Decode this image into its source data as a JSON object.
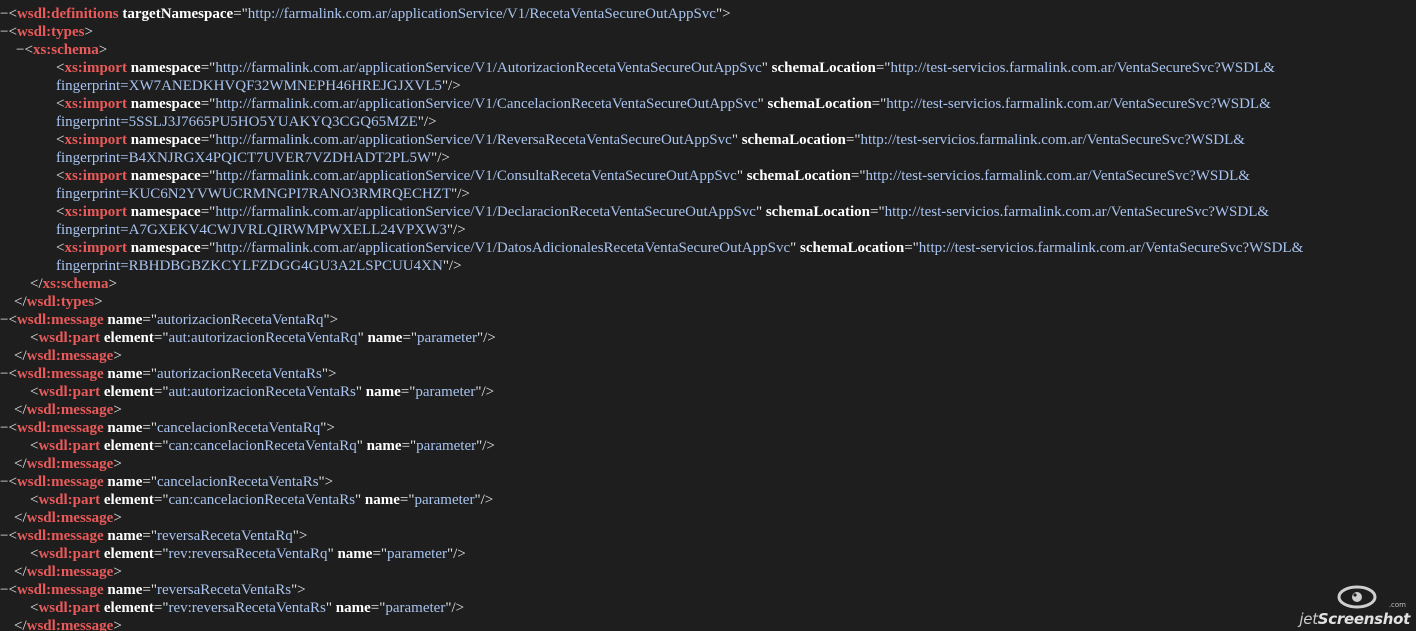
{
  "lines": [
    {
      "indent": 0,
      "fold": "−",
      "tokens": [
        [
          "p",
          "<"
        ],
        [
          "t",
          "wsdl:definitions"
        ],
        [
          "p",
          " "
        ],
        [
          "a",
          "targetNamespace"
        ],
        [
          "p",
          "=\""
        ],
        [
          "v",
          "http://farmalink.com.ar/applicationService/V1/RecetaVentaSecureOutAppSvc"
        ],
        [
          "p",
          "\">"
        ]
      ]
    },
    {
      "indent": 1,
      "fold": "−",
      "tokens": [
        [
          "p",
          "<"
        ],
        [
          "t",
          "wsdl:types"
        ],
        [
          "p",
          ">"
        ]
      ]
    },
    {
      "indent": 2,
      "fold": "−",
      "tokens": [
        [
          "p",
          "<"
        ],
        [
          "t",
          "xs:schema"
        ],
        [
          "p",
          ">"
        ]
      ]
    },
    {
      "indent": 3,
      "fold": "",
      "tokens": [
        [
          "p",
          "<"
        ],
        [
          "t",
          "xs:import"
        ],
        [
          "p",
          " "
        ],
        [
          "a",
          "namespace"
        ],
        [
          "p",
          "=\""
        ],
        [
          "v",
          "http://farmalink.com.ar/applicationService/V1/AutorizacionRecetaVentaSecureOutAppSvc"
        ],
        [
          "p",
          "\" "
        ],
        [
          "a",
          "schemaLocation"
        ],
        [
          "p",
          "=\""
        ],
        [
          "v",
          "http://test-servicios.farmalink.com.ar/VentaSecureSvc?WSDL&"
        ]
      ]
    },
    {
      "indent": 3,
      "fold": "",
      "tokens": [
        [
          "v",
          "fingerprint=XW7ANEDKHVQF32WMNEPH46HREJGJXVL5"
        ],
        [
          "p",
          "\"/>"
        ]
      ]
    },
    {
      "indent": 3,
      "fold": "",
      "tokens": [
        [
          "p",
          "<"
        ],
        [
          "t",
          "xs:import"
        ],
        [
          "p",
          " "
        ],
        [
          "a",
          "namespace"
        ],
        [
          "p",
          "=\""
        ],
        [
          "v",
          "http://farmalink.com.ar/applicationService/V1/CancelacionRecetaVentaSecureOutAppSvc"
        ],
        [
          "p",
          "\" "
        ],
        [
          "a",
          "schemaLocation"
        ],
        [
          "p",
          "=\""
        ],
        [
          "v",
          "http://test-servicios.farmalink.com.ar/VentaSecureSvc?WSDL&"
        ]
      ]
    },
    {
      "indent": 3,
      "fold": "",
      "tokens": [
        [
          "v",
          "fingerprint=5SSLJ3J7665PU5HO5YUAKYQ3CGQ65MZE"
        ],
        [
          "p",
          "\"/>"
        ]
      ]
    },
    {
      "indent": 3,
      "fold": "",
      "tokens": [
        [
          "p",
          "<"
        ],
        [
          "t",
          "xs:import"
        ],
        [
          "p",
          " "
        ],
        [
          "a",
          "namespace"
        ],
        [
          "p",
          "=\""
        ],
        [
          "v",
          "http://farmalink.com.ar/applicationService/V1/ReversaRecetaVentaSecureOutAppSvc"
        ],
        [
          "p",
          "\" "
        ],
        [
          "a",
          "schemaLocation"
        ],
        [
          "p",
          "=\""
        ],
        [
          "v",
          "http://test-servicios.farmalink.com.ar/VentaSecureSvc?WSDL&"
        ]
      ]
    },
    {
      "indent": 3,
      "fold": "",
      "tokens": [
        [
          "v",
          "fingerprint=B4XNJRGX4PQICT7UVER7VZDHADT2PL5W"
        ],
        [
          "p",
          "\"/>"
        ]
      ]
    },
    {
      "indent": 3,
      "fold": "",
      "tokens": [
        [
          "p",
          "<"
        ],
        [
          "t",
          "xs:import"
        ],
        [
          "p",
          " "
        ],
        [
          "a",
          "namespace"
        ],
        [
          "p",
          "=\""
        ],
        [
          "v",
          "http://farmalink.com.ar/applicationService/V1/ConsultaRecetaVentaSecureOutAppSvc"
        ],
        [
          "p",
          "\" "
        ],
        [
          "a",
          "schemaLocation"
        ],
        [
          "p",
          "=\""
        ],
        [
          "v",
          "http://test-servicios.farmalink.com.ar/VentaSecureSvc?WSDL&"
        ]
      ]
    },
    {
      "indent": 3,
      "fold": "",
      "tokens": [
        [
          "v",
          "fingerprint=KUC6N2YVWUCRMNGPI7RANO3RMRQECHZT"
        ],
        [
          "p",
          "\"/>"
        ]
      ]
    },
    {
      "indent": 3,
      "fold": "",
      "tokens": [
        [
          "p",
          "<"
        ],
        [
          "t",
          "xs:import"
        ],
        [
          "p",
          " "
        ],
        [
          "a",
          "namespace"
        ],
        [
          "p",
          "=\""
        ],
        [
          "v",
          "http://farmalink.com.ar/applicationService/V1/DeclaracionRecetaVentaSecureOutAppSvc"
        ],
        [
          "p",
          "\" "
        ],
        [
          "a",
          "schemaLocation"
        ],
        [
          "p",
          "=\""
        ],
        [
          "v",
          "http://test-servicios.farmalink.com.ar/VentaSecureSvc?WSDL&"
        ]
      ]
    },
    {
      "indent": 3,
      "fold": "",
      "tokens": [
        [
          "v",
          "fingerprint=A7GXEKV4CWJVRLQIRWMPWXELL24VPXW3"
        ],
        [
          "p",
          "\"/>"
        ]
      ]
    },
    {
      "indent": 3,
      "fold": "",
      "tokens": [
        [
          "p",
          "<"
        ],
        [
          "t",
          "xs:import"
        ],
        [
          "p",
          " "
        ],
        [
          "a",
          "namespace"
        ],
        [
          "p",
          "=\""
        ],
        [
          "v",
          "http://farmalink.com.ar/applicationService/V1/DatosAdicionalesRecetaVentaSecureOutAppSvc"
        ],
        [
          "p",
          "\" "
        ],
        [
          "a",
          "schemaLocation"
        ],
        [
          "p",
          "=\""
        ],
        [
          "v",
          "http://test-servicios.farmalink.com.ar/VentaSecureSvc?WSDL&"
        ]
      ]
    },
    {
      "indent": 3,
      "fold": "",
      "tokens": [
        [
          "v",
          "fingerprint=RBHDBGBZKCYLFZDGG4GU3A2LSPCUU4XN"
        ],
        [
          "p",
          "\"/>"
        ]
      ]
    },
    {
      "indent": 2,
      "fold": "",
      "tokens": [
        [
          "p",
          "</"
        ],
        [
          "t",
          "xs:schema"
        ],
        [
          "p",
          ">"
        ]
      ]
    },
    {
      "indent": 1,
      "fold": "",
      "tokens": [
        [
          "p",
          "</"
        ],
        [
          "t",
          "wsdl:types"
        ],
        [
          "p",
          ">"
        ]
      ]
    },
    {
      "indent": 1,
      "fold": "−",
      "tokens": [
        [
          "p",
          "<"
        ],
        [
          "t",
          "wsdl:message"
        ],
        [
          "p",
          " "
        ],
        [
          "a",
          "name"
        ],
        [
          "p",
          "=\""
        ],
        [
          "v",
          "autorizacionRecetaVentaRq"
        ],
        [
          "p",
          "\">"
        ]
      ]
    },
    {
      "indent": 2,
      "fold": "",
      "tokens": [
        [
          "p",
          "<"
        ],
        [
          "t",
          "wsdl:part"
        ],
        [
          "p",
          " "
        ],
        [
          "a",
          "element"
        ],
        [
          "p",
          "=\""
        ],
        [
          "v",
          "aut:autorizacionRecetaVentaRq"
        ],
        [
          "p",
          "\" "
        ],
        [
          "a",
          "name"
        ],
        [
          "p",
          "=\""
        ],
        [
          "v",
          "parameter"
        ],
        [
          "p",
          "\"/>"
        ]
      ]
    },
    {
      "indent": 1,
      "fold": "",
      "tokens": [
        [
          "p",
          "</"
        ],
        [
          "t",
          "wsdl:message"
        ],
        [
          "p",
          ">"
        ]
      ]
    },
    {
      "indent": 1,
      "fold": "−",
      "tokens": [
        [
          "p",
          "<"
        ],
        [
          "t",
          "wsdl:message"
        ],
        [
          "p",
          " "
        ],
        [
          "a",
          "name"
        ],
        [
          "p",
          "=\""
        ],
        [
          "v",
          "autorizacionRecetaVentaRs"
        ],
        [
          "p",
          "\">"
        ]
      ]
    },
    {
      "indent": 2,
      "fold": "",
      "tokens": [
        [
          "p",
          "<"
        ],
        [
          "t",
          "wsdl:part"
        ],
        [
          "p",
          " "
        ],
        [
          "a",
          "element"
        ],
        [
          "p",
          "=\""
        ],
        [
          "v",
          "aut:autorizacionRecetaVentaRs"
        ],
        [
          "p",
          "\" "
        ],
        [
          "a",
          "name"
        ],
        [
          "p",
          "=\""
        ],
        [
          "v",
          "parameter"
        ],
        [
          "p",
          "\"/>"
        ]
      ]
    },
    {
      "indent": 1,
      "fold": "",
      "tokens": [
        [
          "p",
          "</"
        ],
        [
          "t",
          "wsdl:message"
        ],
        [
          "p",
          ">"
        ]
      ]
    },
    {
      "indent": 1,
      "fold": "−",
      "tokens": [
        [
          "p",
          "<"
        ],
        [
          "t",
          "wsdl:message"
        ],
        [
          "p",
          " "
        ],
        [
          "a",
          "name"
        ],
        [
          "p",
          "=\""
        ],
        [
          "v",
          "cancelacionRecetaVentaRq"
        ],
        [
          "p",
          "\">"
        ]
      ]
    },
    {
      "indent": 2,
      "fold": "",
      "tokens": [
        [
          "p",
          "<"
        ],
        [
          "t",
          "wsdl:part"
        ],
        [
          "p",
          " "
        ],
        [
          "a",
          "element"
        ],
        [
          "p",
          "=\""
        ],
        [
          "v",
          "can:cancelacionRecetaVentaRq"
        ],
        [
          "p",
          "\" "
        ],
        [
          "a",
          "name"
        ],
        [
          "p",
          "=\""
        ],
        [
          "v",
          "parameter"
        ],
        [
          "p",
          "\"/>"
        ]
      ]
    },
    {
      "indent": 1,
      "fold": "",
      "tokens": [
        [
          "p",
          "</"
        ],
        [
          "t",
          "wsdl:message"
        ],
        [
          "p",
          ">"
        ]
      ]
    },
    {
      "indent": 1,
      "fold": "−",
      "tokens": [
        [
          "p",
          "<"
        ],
        [
          "t",
          "wsdl:message"
        ],
        [
          "p",
          " "
        ],
        [
          "a",
          "name"
        ],
        [
          "p",
          "=\""
        ],
        [
          "v",
          "cancelacionRecetaVentaRs"
        ],
        [
          "p",
          "\">"
        ]
      ]
    },
    {
      "indent": 2,
      "fold": "",
      "tokens": [
        [
          "p",
          "<"
        ],
        [
          "t",
          "wsdl:part"
        ],
        [
          "p",
          " "
        ],
        [
          "a",
          "element"
        ],
        [
          "p",
          "=\""
        ],
        [
          "v",
          "can:cancelacionRecetaVentaRs"
        ],
        [
          "p",
          "\" "
        ],
        [
          "a",
          "name"
        ],
        [
          "p",
          "=\""
        ],
        [
          "v",
          "parameter"
        ],
        [
          "p",
          "\"/>"
        ]
      ]
    },
    {
      "indent": 1,
      "fold": "",
      "tokens": [
        [
          "p",
          "</"
        ],
        [
          "t",
          "wsdl:message"
        ],
        [
          "p",
          ">"
        ]
      ]
    },
    {
      "indent": 1,
      "fold": "−",
      "tokens": [
        [
          "p",
          "<"
        ],
        [
          "t",
          "wsdl:message"
        ],
        [
          "p",
          " "
        ],
        [
          "a",
          "name"
        ],
        [
          "p",
          "=\""
        ],
        [
          "v",
          "reversaRecetaVentaRq"
        ],
        [
          "p",
          "\">"
        ]
      ]
    },
    {
      "indent": 2,
      "fold": "",
      "tokens": [
        [
          "p",
          "<"
        ],
        [
          "t",
          "wsdl:part"
        ],
        [
          "p",
          " "
        ],
        [
          "a",
          "element"
        ],
        [
          "p",
          "=\""
        ],
        [
          "v",
          "rev:reversaRecetaVentaRq"
        ],
        [
          "p",
          "\" "
        ],
        [
          "a",
          "name"
        ],
        [
          "p",
          "=\""
        ],
        [
          "v",
          "parameter"
        ],
        [
          "p",
          "\"/>"
        ]
      ]
    },
    {
      "indent": 1,
      "fold": "",
      "tokens": [
        [
          "p",
          "</"
        ],
        [
          "t",
          "wsdl:message"
        ],
        [
          "p",
          ">"
        ]
      ]
    },
    {
      "indent": 1,
      "fold": "−",
      "tokens": [
        [
          "p",
          "<"
        ],
        [
          "t",
          "wsdl:message"
        ],
        [
          "p",
          " "
        ],
        [
          "a",
          "name"
        ],
        [
          "p",
          "=\""
        ],
        [
          "v",
          "reversaRecetaVentaRs"
        ],
        [
          "p",
          "\">"
        ]
      ]
    },
    {
      "indent": 2,
      "fold": "",
      "tokens": [
        [
          "p",
          "<"
        ],
        [
          "t",
          "wsdl:part"
        ],
        [
          "p",
          " "
        ],
        [
          "a",
          "element"
        ],
        [
          "p",
          "=\""
        ],
        [
          "v",
          "rev:reversaRecetaVentaRs"
        ],
        [
          "p",
          "\" "
        ],
        [
          "a",
          "name"
        ],
        [
          "p",
          "=\""
        ],
        [
          "v",
          "parameter"
        ],
        [
          "p",
          "\"/>"
        ]
      ]
    },
    {
      "indent": 1,
      "fold": "",
      "tokens": [
        [
          "p",
          "</"
        ],
        [
          "t",
          "wsdl:message"
        ],
        [
          "p",
          ">"
        ]
      ]
    }
  ],
  "watermark": {
    "text_light": "jet",
    "text_bold": "Screenshot",
    "suffix": ".com"
  },
  "colors": {
    "background": "#1e1e1e",
    "tag": "#ea5a5a",
    "attribute": "#ffffff",
    "value": "#a8c3ef",
    "punctuation": "#e6e6e6"
  }
}
